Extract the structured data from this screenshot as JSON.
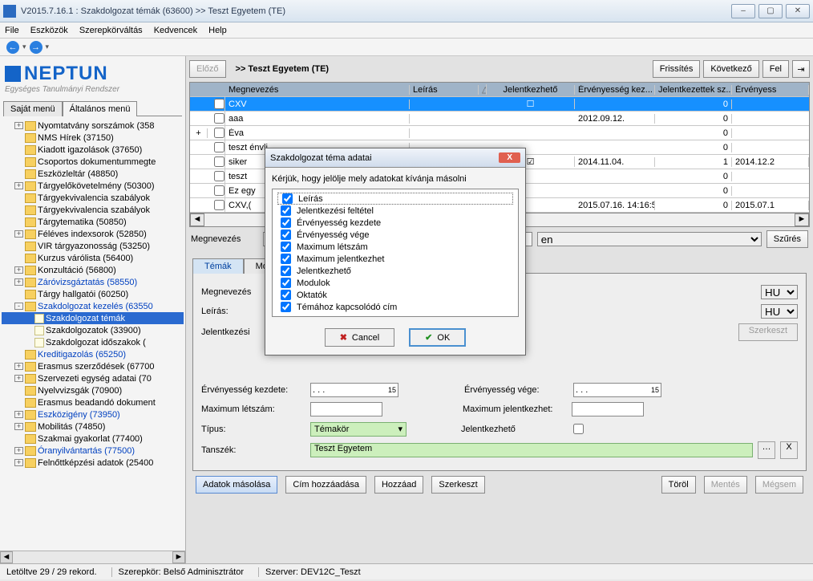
{
  "window": {
    "title": "V2015.7.16.1 : Szakdolgozat témák (63600)  >> Teszt Egyetem (TE)"
  },
  "menu": {
    "file": "File",
    "tools": "Eszközök",
    "roleswitch": "Szerepkörváltás",
    "favorites": "Kedvencek",
    "help": "Help"
  },
  "logo": {
    "main": "NEPTUN",
    "sub": "Egységes Tanulmányi Rendszer"
  },
  "left_tabs": {
    "own": "Saját menü",
    "general": "Általános menü"
  },
  "tree": {
    "items": [
      {
        "t": "Nyomtatvány sorszámok (358",
        "blue": false,
        "exp": "+",
        "lvl": 1,
        "icon": "folder"
      },
      {
        "t": "NMS Hírek (37150)",
        "blue": false,
        "exp": "",
        "lvl": 1,
        "icon": "folder"
      },
      {
        "t": "Kiadott igazolások (37650)",
        "blue": false,
        "exp": "",
        "lvl": 1,
        "icon": "folder"
      },
      {
        "t": "Csoportos dokumentummegte",
        "blue": false,
        "exp": "",
        "lvl": 1,
        "icon": "folder"
      },
      {
        "t": "Eszközleltár (48850)",
        "blue": false,
        "exp": "",
        "lvl": 1,
        "icon": "folder"
      },
      {
        "t": "Tárgyelőkövetelmény (50300)",
        "blue": false,
        "exp": "+",
        "lvl": 1,
        "icon": "folder"
      },
      {
        "t": "Tárgyekvivalencia szabályok",
        "blue": false,
        "exp": "",
        "lvl": 1,
        "icon": "folder"
      },
      {
        "t": "Tárgyekvivalencia szabályok",
        "blue": false,
        "exp": "",
        "lvl": 1,
        "icon": "folder"
      },
      {
        "t": "Tárgytematika (50850)",
        "blue": false,
        "exp": "",
        "lvl": 1,
        "icon": "folder"
      },
      {
        "t": "Féléves indexsorok (52850)",
        "blue": false,
        "exp": "+",
        "lvl": 1,
        "icon": "folder"
      },
      {
        "t": "VIR tárgyazonosság (53250)",
        "blue": false,
        "exp": "",
        "lvl": 1,
        "icon": "folder"
      },
      {
        "t": "Kurzus várólista (56400)",
        "blue": false,
        "exp": "",
        "lvl": 1,
        "icon": "folder"
      },
      {
        "t": "Konzultáció (56800)",
        "blue": false,
        "exp": "+",
        "lvl": 1,
        "icon": "folder"
      },
      {
        "t": "Záróvizsgáztatás (58550)",
        "blue": true,
        "exp": "+",
        "lvl": 1,
        "icon": "folder"
      },
      {
        "t": "Tárgy hallgatói (60250)",
        "blue": false,
        "exp": "",
        "lvl": 1,
        "icon": "folder"
      },
      {
        "t": "Szakdolgozat kezelés (63550",
        "blue": true,
        "exp": "-",
        "lvl": 1,
        "icon": "folder"
      },
      {
        "t": "Szakdolgozat témák",
        "blue": false,
        "exp": "none",
        "lvl": 2,
        "icon": "page",
        "sel": true
      },
      {
        "t": "Szakdolgozatok (33900)",
        "blue": false,
        "exp": "none",
        "lvl": 2,
        "icon": "page"
      },
      {
        "t": "Szakdolgozat időszakok (",
        "blue": false,
        "exp": "none",
        "lvl": 2,
        "icon": "page"
      },
      {
        "t": "Kreditigazolás (65250)",
        "blue": true,
        "exp": "",
        "lvl": 1,
        "icon": "folder"
      },
      {
        "t": "Erasmus szerződések (67700",
        "blue": false,
        "exp": "+",
        "lvl": 1,
        "icon": "folder"
      },
      {
        "t": "Szervezeti egység adatai (70",
        "blue": false,
        "exp": "+",
        "lvl": 1,
        "icon": "folder"
      },
      {
        "t": "Nyelvvizsgák (70900)",
        "blue": false,
        "exp": "",
        "lvl": 1,
        "icon": "folder"
      },
      {
        "t": "Erasmus beadandó dokument",
        "blue": false,
        "exp": "",
        "lvl": 1,
        "icon": "folder"
      },
      {
        "t": "Eszközigény (73950)",
        "blue": true,
        "exp": "+",
        "lvl": 1,
        "icon": "folder"
      },
      {
        "t": "Mobilitás (74850)",
        "blue": false,
        "exp": "+",
        "lvl": 1,
        "icon": "folder"
      },
      {
        "t": "Szakmai gyakorlat (77400)",
        "blue": false,
        "exp": "",
        "lvl": 1,
        "icon": "folder"
      },
      {
        "t": "Óranyilvántartás (77500)",
        "blue": true,
        "exp": "+",
        "lvl": 1,
        "icon": "folder"
      },
      {
        "t": "Felnőttképzési adatok (25400",
        "blue": false,
        "exp": "+",
        "lvl": 1,
        "icon": "folder"
      }
    ]
  },
  "right": {
    "prev_btn": "Előző",
    "head_title": ">>  Teszt Egyetem (TE)",
    "refresh_btn": "Frissítés",
    "next_btn": "Következő",
    "up_btn": "Fel"
  },
  "grid": {
    "headers": {
      "name": "Megnevezés",
      "desc": "Leírás",
      "jel": "Jelentkezhető",
      "erv": "Érvényesség kez...",
      "jsz": "Jelentkezettek sz...",
      "erv2": "Érvényess"
    },
    "rows": [
      {
        "exp": "",
        "name": "CXV",
        "desc": "",
        "jel": "☐",
        "erv": "",
        "jsz": "0",
        "erv2": "",
        "sel": true
      },
      {
        "exp": "",
        "name": "aaa",
        "desc": "",
        "jel": "",
        "erv": "2012.09.12.",
        "jsz": "0",
        "erv2": ""
      },
      {
        "exp": "+",
        "name": "Éva",
        "desc": "",
        "jel": "",
        "erv": "",
        "jsz": "0",
        "erv2": ""
      },
      {
        "exp": "",
        "name": "teszt énvlj",
        "desc": "",
        "jel": "",
        "erv": "",
        "jsz": "0",
        "erv2": ""
      },
      {
        "exp": "",
        "name": "siker",
        "desc": "",
        "jel": "☑",
        "erv": "2014.11.04.",
        "jsz": "1",
        "erv2": "2014.12.2"
      },
      {
        "exp": "",
        "name": "teszt",
        "desc": "",
        "jel": "",
        "erv": "",
        "jsz": "0",
        "erv2": ""
      },
      {
        "exp": "",
        "name": "Ez egy",
        "desc": "",
        "jel": "",
        "erv": "",
        "jsz": "0",
        "erv2": ""
      },
      {
        "exp": "",
        "name": "CXV,(",
        "desc": "",
        "jel": "",
        "erv": "2015.07.16. 14:16:5",
        "jsz": "0",
        "erv2": "2015.07.1"
      }
    ]
  },
  "filter": {
    "name_label": "Megnevezés",
    "select_value": "en",
    "filter_btn": "Szűrés"
  },
  "form_tabs": {
    "temak": "Témák",
    "mod": "Mod"
  },
  "form": {
    "name_label": "Megnevezés",
    "desc_label": "Leírás:",
    "jel_label": "Jelentkezési",
    "hu": "HU",
    "edit_btn": "Szerkeszt",
    "erv_kezd": "Érvényesség kezdete:",
    "erv_vege": "Érvényesség vége:",
    "date_placeholder": ".  .  .",
    "max_letszam": "Maximum létszám:",
    "max_jelentkezhet": "Maximum jelentkezhet:",
    "tipus": "Típus:",
    "tipus_value": "Témakör",
    "jel2": "Jelentkezhető",
    "tanszek": "Tanszék:",
    "tanszek_value": "Teszt Egyetem"
  },
  "bottom_buttons": {
    "copy": "Adatok másolása",
    "addtitle": "Cím hozzáadása",
    "add": "Hozzáad",
    "edit": "Szerkeszt",
    "del": "Töröl",
    "save": "Mentés",
    "cancel": "Mégsem"
  },
  "modal": {
    "title": "Szakdolgozat téma adatai",
    "msg": "Kérjük, hogy jelölje mely adatokat kívánja másolni",
    "items": [
      "Leírás",
      "Jelentkezési feltétel",
      "Érvényesség kezdete",
      "Érvényesség vége",
      "Maximum létszám",
      "Maximum jelentkezhet",
      "Jelentkezhető",
      "Modulok",
      "Oktatók",
      "Témához kapcsolódó cím"
    ],
    "cancel": "Cancel",
    "ok": "OK"
  },
  "status": {
    "records": "Letöltve 29 / 29 rekord.",
    "role": "Szerepkör: Belső Adminisztrátor",
    "server": "Szerver: DEV12C_Teszt"
  }
}
